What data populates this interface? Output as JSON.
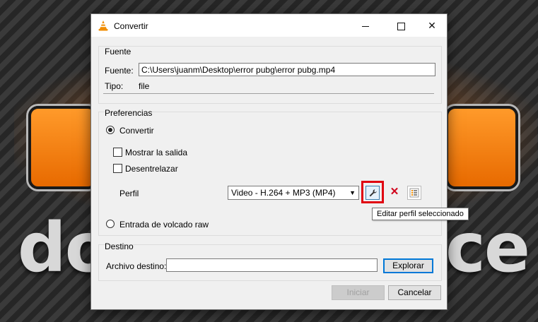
{
  "window": {
    "title": "Convertir"
  },
  "fuente": {
    "group_label": "Fuente",
    "fuente_label": "Fuente:",
    "fuente_value": "C:\\Users\\juanm\\Desktop\\error pubg\\error pubg.mp4",
    "tipo_label": "Tipo:",
    "tipo_value": "file"
  },
  "preferencias": {
    "group_label": "Preferencias",
    "convertir_label": "Convertir",
    "convertir_selected": true,
    "mostrar_salida_label": "Mostrar la salida",
    "mostrar_salida_checked": false,
    "desentrelazar_label": "Desentrelazar",
    "desentrelazar_checked": false,
    "perfil_label": "Perfil",
    "perfil_value": "Video - H.264 + MP3 (MP4)",
    "edit_profile_tooltip": "Editar perfil seleccionado",
    "raw_dump_label": "Entrada de volcado raw",
    "raw_dump_selected": false
  },
  "destino": {
    "group_label": "Destino",
    "archivo_label": "Archivo destino:",
    "archivo_value": "",
    "explorar_label": "Explorar"
  },
  "footer": {
    "iniciar_label": "Iniciar",
    "cancelar_label": "Cancelar"
  },
  "background": {
    "text_left": "do",
    "text_right": "ce"
  },
  "colors": {
    "highlight": "#e00010",
    "accent": "#0078d7",
    "vlc_orange": "#f08c00"
  },
  "icons": {
    "app": "vlc-cone-icon",
    "edit": "wrench-icon",
    "delete": "red-x-icon",
    "new": "new-profile-icon"
  }
}
